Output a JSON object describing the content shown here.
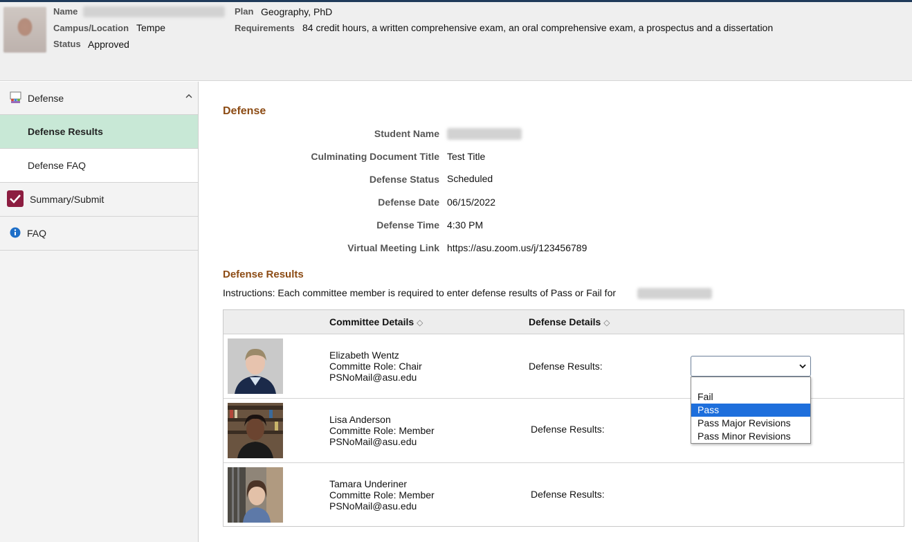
{
  "header": {
    "name_label": "Name",
    "campus_label": "Campus/Location",
    "campus_value": "Tempe",
    "status_label": "Status",
    "status_value": "Approved",
    "plan_label": "Plan",
    "plan_value": "Geography, PhD",
    "requirements_label": "Requirements",
    "requirements_value": "84 credit hours, a written comprehensive exam, an oral comprehensive exam, a prospectus and a dissertation"
  },
  "sidebar": {
    "items": [
      {
        "label": "Defense",
        "icon": "defense-people-icon"
      },
      {
        "label": "Defense Results"
      },
      {
        "label": "Defense FAQ"
      },
      {
        "label": "Summary/Submit",
        "icon": "checkbox-checked-icon"
      },
      {
        "label": "FAQ",
        "icon": "info-icon"
      }
    ]
  },
  "main": {
    "title": "Defense",
    "fields": [
      {
        "label": "Student Name",
        "value": ""
      },
      {
        "label": "Culminating Document Title",
        "value": "Test Title"
      },
      {
        "label": "Defense Status",
        "value": "Scheduled"
      },
      {
        "label": "Defense Date",
        "value": "06/15/2022"
      },
      {
        "label": "Defense Time",
        "value": "4:30 PM"
      },
      {
        "label": "Virtual Meeting Link",
        "value": "https://asu.zoom.us/j/123456789"
      }
    ],
    "results_title": "Defense Results",
    "instructions": "Instructions: Each committee member is required to enter defense results of Pass or Fail for"
  },
  "grid": {
    "headers": [
      "Committee Details",
      "Defense Details"
    ],
    "rows": [
      {
        "name": "Elizabeth Wentz",
        "role": "Committe Role: Chair",
        "email": "PSNoMail@asu.edu",
        "defense_label": "Defense Results:"
      },
      {
        "name": "Lisa Anderson",
        "role": "Committe Role: Member",
        "email": "PSNoMail@asu.edu",
        "defense_label": "Defense Results:"
      },
      {
        "name": "Tamara Underiner",
        "role": "Committe Role: Member",
        "email": "PSNoMail@asu.edu",
        "defense_label": "Defense Results:"
      }
    ]
  },
  "dropdown": {
    "selected": "",
    "options": [
      "",
      "Fail",
      "Pass",
      "Pass Major Revisions",
      "Pass Minor Revisions"
    ],
    "highlighted": "Pass"
  },
  "colors": {
    "accent_brown": "#8c4b14",
    "selected_nav": "#c8e8d6",
    "option_highlight": "#1e6fdc"
  }
}
